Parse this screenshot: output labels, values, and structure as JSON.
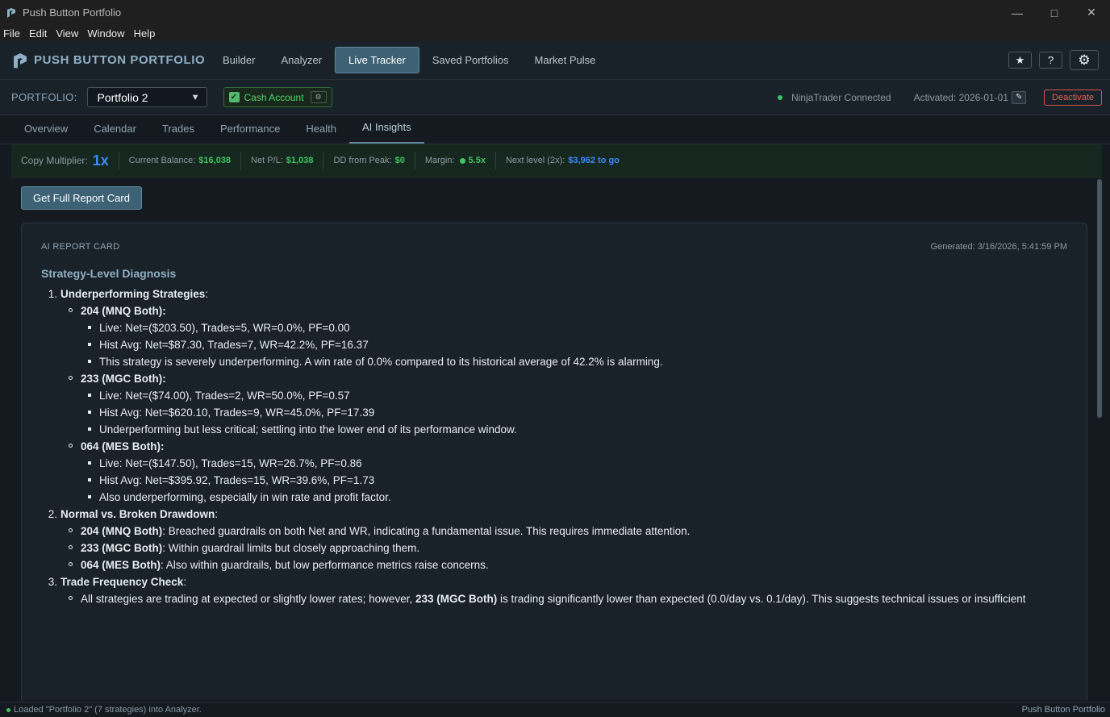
{
  "window": {
    "title": "Push Button Portfolio"
  },
  "menu": [
    "File",
    "Edit",
    "View",
    "Window",
    "Help"
  ],
  "brand": {
    "name": "PUSH BUTTON PORTFOLIO"
  },
  "nav": {
    "tabs": [
      "Builder",
      "Analyzer",
      "Live Tracker",
      "Saved Portfolios",
      "Market Pulse"
    ],
    "active": "Live Tracker"
  },
  "portfolio": {
    "label": "PORTFOLIO:",
    "selected": "Portfolio 2",
    "cash_label": "Cash Account",
    "connection": "NinjaTrader Connected",
    "activated": "Activated: 2026-01-01",
    "deactivate": "Deactivate"
  },
  "subtabs": {
    "items": [
      "Overview",
      "Calendar",
      "Trades",
      "Performance",
      "Health",
      "AI Insights"
    ],
    "active": "AI Insights"
  },
  "status": {
    "copy_label": "Copy Multiplier:",
    "copy_value": "1x",
    "balance_label": "Current Balance:",
    "balance_value": "$16,038",
    "pl_label": "Net P/L:",
    "pl_value": "$1,038",
    "dd_label": "DD from Peak:",
    "dd_value": "$0",
    "margin_label": "Margin:",
    "margin_value": "5.5x",
    "next_label": "Next level (2x):",
    "next_value": "$3,962 to go"
  },
  "report_button": "Get Full Report Card",
  "report": {
    "heading": "AI REPORT CARD",
    "generated": "Generated: 3/16/2026, 5:41:59 PM",
    "section_title": "Strategy-Level Diagnosis",
    "items": [
      {
        "n": "1.",
        "title": "Underperforming Strategies",
        "suffix": ":"
      },
      {
        "n": "2.",
        "title": "Normal vs. Broken Drawdown",
        "suffix": ":"
      },
      {
        "n": "3.",
        "title": "Trade Frequency Check",
        "suffix": ":"
      }
    ],
    "s1": [
      {
        "name": "204 (MNQ Both)",
        "lines": [
          "Live: Net=($203.50), Trades=5, WR=0.0%, PF=0.00",
          "Hist Avg: Net=$87.30, Trades=7, WR=42.2%, PF=16.37",
          "This strategy is severely underperforming. A win rate of 0.0% compared to its historical average of 42.2% is alarming."
        ]
      },
      {
        "name": "233 (MGC Both)",
        "lines": [
          "Live: Net=($74.00), Trades=2, WR=50.0%, PF=0.57",
          "Hist Avg: Net=$620.10, Trades=9, WR=45.0%, PF=17.39",
          "Underperforming but less critical; settling into the lower end of its performance window."
        ]
      },
      {
        "name": "064 (MES Both)",
        "lines": [
          "Live: Net=($147.50), Trades=15, WR=26.7%, PF=0.86",
          "Hist Avg: Net=$395.92, Trades=15, WR=39.6%, PF=1.73",
          "Also underperforming, especially in win rate and profit factor."
        ]
      }
    ],
    "s2": [
      {
        "name": "204 (MNQ Both)",
        "text": ": Breached guardrails on both Net and WR, indicating a fundamental issue. This requires immediate attention."
      },
      {
        "name": "233 (MGC Both)",
        "text": ": Within guardrail limits but closely approaching them."
      },
      {
        "name": "064 (MES Both)",
        "text": ": Also within guardrails, but low performance metrics raise concerns."
      }
    ],
    "s3": {
      "pre": "All strategies are trading at expected or slightly lower rates; however, ",
      "bold": "233 (MGC Both)",
      "post": " is trading significantly lower than expected (0.0/day vs. 0.1/day). This suggests technical issues or insufficient"
    }
  },
  "footer": {
    "left": "Loaded \"Portfolio 2\" (7 strategies) into Analyzer.",
    "right": "Push Button Portfolio"
  },
  "colors": {
    "accent": "#3d6275",
    "green": "#41c463",
    "blue": "#3b8bff",
    "danger": "#e0605a"
  },
  "icons": [
    "app-logo-icon",
    "minimize-icon",
    "maximize-icon",
    "close-icon",
    "sun-icon",
    "help-icon",
    "gear-icon",
    "chevron-down-icon",
    "checkbox-icon",
    "pencil-icon"
  ]
}
